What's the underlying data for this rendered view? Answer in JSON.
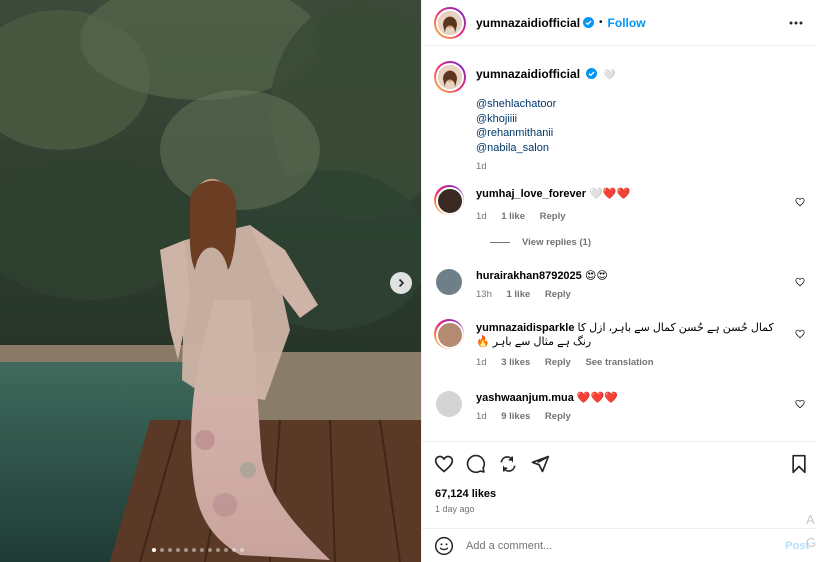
{
  "post": {
    "username": "yumnazaidiofficial",
    "follow_label": "Follow",
    "separator": "•",
    "caption_emoji": "🤍",
    "mentions": [
      "@shehlachatoor",
      "@khojiiii",
      "@rehanmithanii",
      "@nabila_salon"
    ],
    "caption_age": "1d",
    "carousel": {
      "total_slides": 12,
      "active_index": 0
    }
  },
  "comments": [
    {
      "user": "yumhaj_love_forever",
      "text": "🤍❤️❤️",
      "age": "1d",
      "likes": "1 like",
      "reply": "Reply",
      "view_replies": "View replies (1)"
    },
    {
      "user": "hurairakhan8792025",
      "text": "😍😍",
      "age": "13h",
      "likes": "1 like",
      "reply": "Reply"
    },
    {
      "user": "yumnazaidisparkle",
      "text": "کمال حُسن ہے حُسن کمال سے باہر، ازل کا رنگ ہے مثال سے باہر 🔥",
      "age": "1d",
      "likes": "3 likes",
      "reply": "Reply",
      "translation": "See translation"
    },
    {
      "user": "yashwaanjum.mua",
      "text": "❤️❤️❤️",
      "age": "1d",
      "likes": "9 likes",
      "reply": "Reply"
    }
  ],
  "stats": {
    "likes": "67,124 likes",
    "date": "1 day ago"
  },
  "add_comment": {
    "placeholder": "Add a comment...",
    "post_label": "Post"
  },
  "overflow_text": {
    "a": "A",
    "g": "G"
  },
  "colors": {
    "link": "#00376b",
    "accent": "#0095f6",
    "muted": "#737373",
    "heart": "#ed4956"
  },
  "icons": [
    "verified-icon",
    "more-icon",
    "heart-icon",
    "comment-icon",
    "share-icon",
    "send-icon",
    "bookmark-icon",
    "emoji-icon",
    "chevron-right-icon"
  ]
}
